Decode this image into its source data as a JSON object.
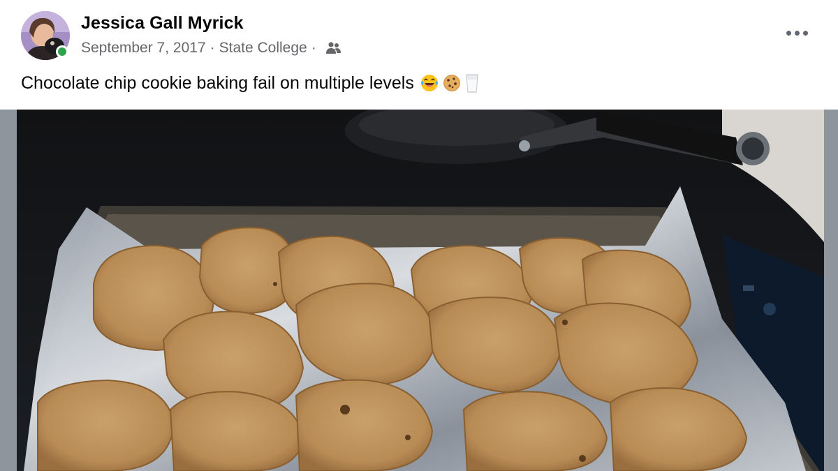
{
  "post": {
    "author": {
      "name": "Jessica Gall Myrick",
      "online": true
    },
    "meta": {
      "date": "September 7, 2017",
      "separator": "·",
      "location": "State College",
      "audience_icon": "friends-icon"
    },
    "text": "Chocolate chip cookie baking fail on multiple levels",
    "emojis": [
      "laughing-crying-emoji",
      "cookie-emoji",
      "milk-glass-emoji"
    ],
    "photo": {
      "description_icon": "cookie-sheet-photo"
    },
    "menu_icon": "more-options-icon"
  },
  "colors": {
    "name": "#050505",
    "meta": "#65676b",
    "online": "#31a24c",
    "photo_frame": "#8f959c"
  }
}
